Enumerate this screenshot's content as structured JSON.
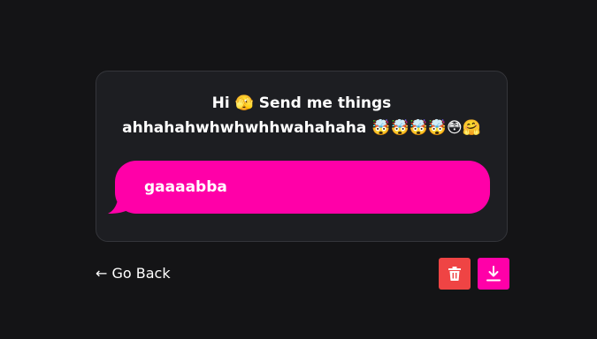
{
  "prompt": {
    "line1": "Hi 🫣 Send me things",
    "line2": "ahhahahwhwhwhhwahahaha 🤯🤯🤯🤯😳🤗"
  },
  "message": {
    "text": "gaaaabba",
    "bubble_color": "#ff00a8"
  },
  "footer": {
    "back_label": "← Go Back",
    "delete_icon": "trash-icon",
    "download_icon": "download-icon",
    "delete_color": "#ef4444",
    "download_color": "#ff00a8"
  },
  "colors": {
    "background": "#141416",
    "card": "#1d1e22",
    "card_border": "#34353a"
  }
}
